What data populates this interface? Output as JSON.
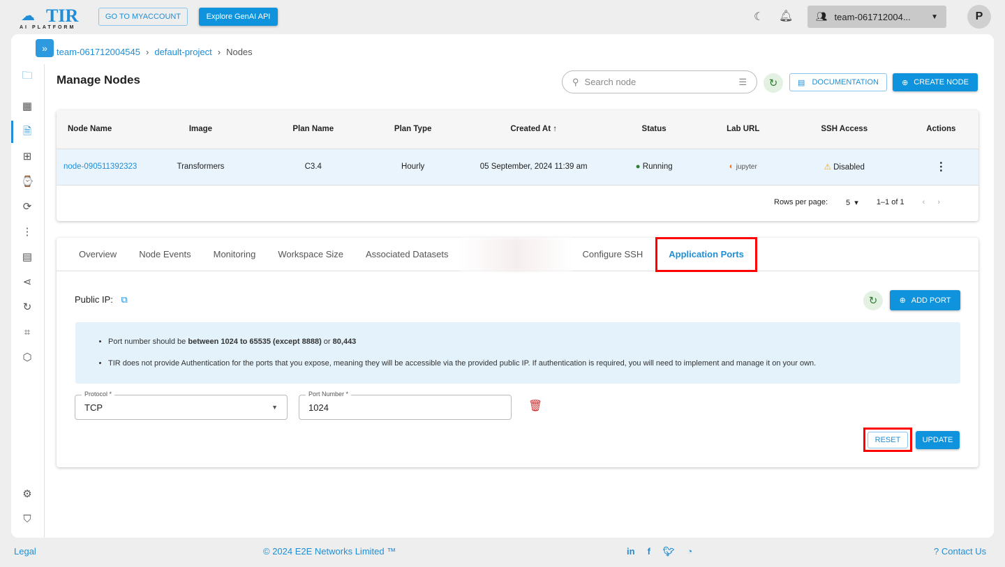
{
  "header": {
    "logo_text": "TIR",
    "logo_sub": "AI PLATFORM",
    "myaccount": "GO TO MYACCOUNT",
    "genai": "Explore GenAI API",
    "team": "team-061712004...",
    "avatar": "P"
  },
  "breadcrumb": [
    "team-061712004545",
    "default-project",
    "Nodes"
  ],
  "page_title": "Manage Nodes",
  "search_placeholder": "Search node",
  "documentation": "DOCUMENTATION",
  "create_node": "CREATE NODE",
  "table": {
    "columns": [
      "Node Name",
      "Image",
      "Plan Name",
      "Plan Type",
      "Created At",
      "Status",
      "Lab URL",
      "SSH Access",
      "Actions"
    ],
    "rows": [
      {
        "name": "node-090511392323",
        "image": "Transformers",
        "plan": "C3.4",
        "type": "Hourly",
        "created": "05 September, 2024 11:39 am",
        "status": "Running",
        "lab": "jupyter",
        "ssh": "Disabled"
      }
    ],
    "rows_per_page_label": "Rows per page:",
    "rows_per_page": "5",
    "range": "1–1 of 1"
  },
  "tabs": [
    "Overview",
    "Node Events",
    "Monitoring",
    "Workspace Size",
    "Associated Datasets",
    "",
    "Configure SSH",
    "Application Ports"
  ],
  "active_tab": "Application Ports",
  "ports": {
    "public_ip_label": "Public IP:",
    "add_port": "ADD PORT",
    "info1_pre": "Port number should be ",
    "info1_bold": "between 1024 to 65535 (except 8888)",
    "info1_mid": " or ",
    "info1_bold2": "80,443",
    "info2": "TIR does not provide Authentication for the ports that you expose, meaning they will be accessible via the provided public IP. If authentication is required, you will need to implement and manage it on your own.",
    "protocol_label": "Protocol *",
    "protocol": "TCP",
    "port_label": "Port Number *",
    "port": "1024",
    "reset": "RESET",
    "update": "UPDATE"
  },
  "footer": {
    "legal": "Legal",
    "copyright": "© 2024 E2E Networks Limited ™",
    "contact": "Contact Us"
  },
  "colors": {
    "accent": "#0e93dc",
    "highlight": "#ff0000",
    "running": "#2e7d32"
  }
}
